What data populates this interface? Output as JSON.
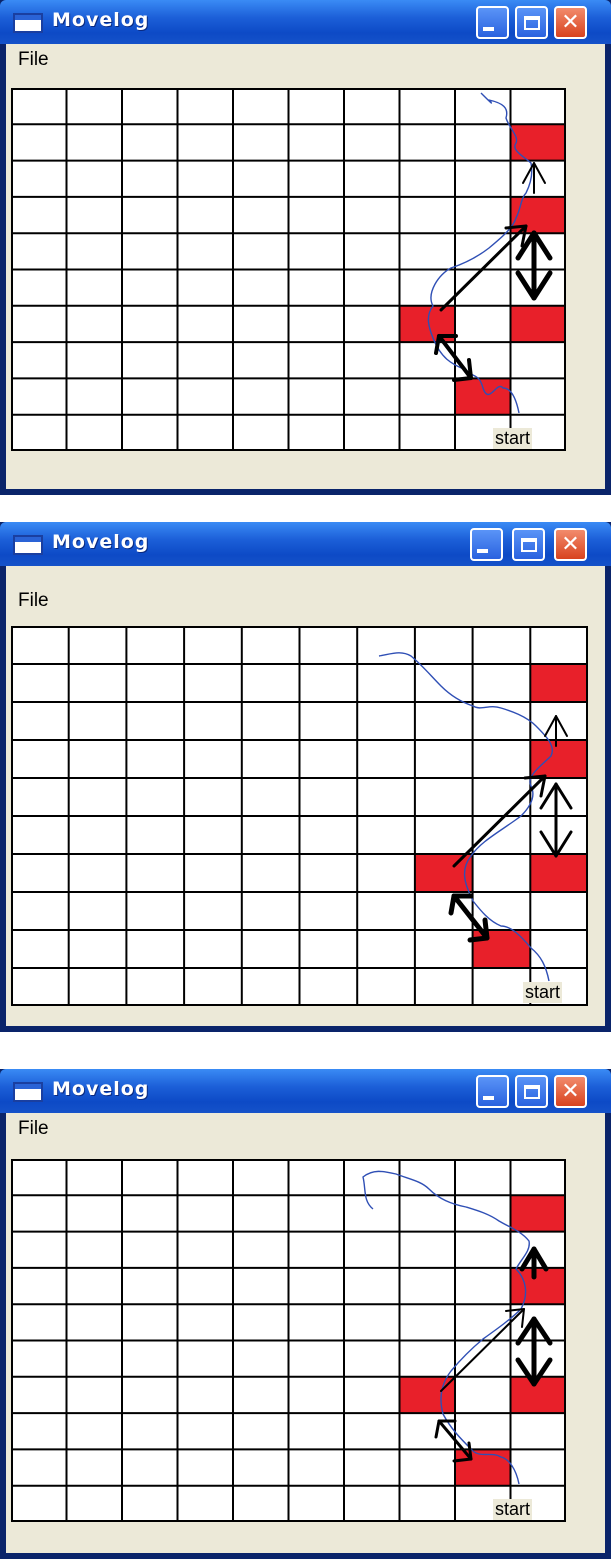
{
  "windows": [
    {
      "title": "Movelog",
      "menu": {
        "file": "File"
      },
      "start_label": "start"
    },
    {
      "title": "Movelog",
      "menu": {
        "file": "File"
      },
      "start_label": "start"
    },
    {
      "title": "Movelog",
      "menu": {
        "file": "File"
      },
      "start_label": "start"
    }
  ],
  "title_buttons": {
    "minimize": "minimize",
    "maximize": "maximize",
    "close": "close"
  },
  "icons": {
    "window": "window-icon",
    "minimize": "minimize-icon",
    "maximize": "maximize-icon",
    "close": "close-icon"
  },
  "colors": {
    "title_bar": "#0d4ac6",
    "highlight_cell": "#e8202a",
    "trail": "#2f4fb5",
    "arrow": "#000000",
    "window_face": "#ece9d8"
  },
  "grid": {
    "rows": 10,
    "cols": 10
  },
  "red_cells": [
    {
      "row": 1,
      "col": 9
    },
    {
      "row": 3,
      "col": 9
    },
    {
      "row": 6,
      "col": 7
    },
    {
      "row": 6,
      "col": 9
    },
    {
      "row": 8,
      "col": 8
    }
  ]
}
